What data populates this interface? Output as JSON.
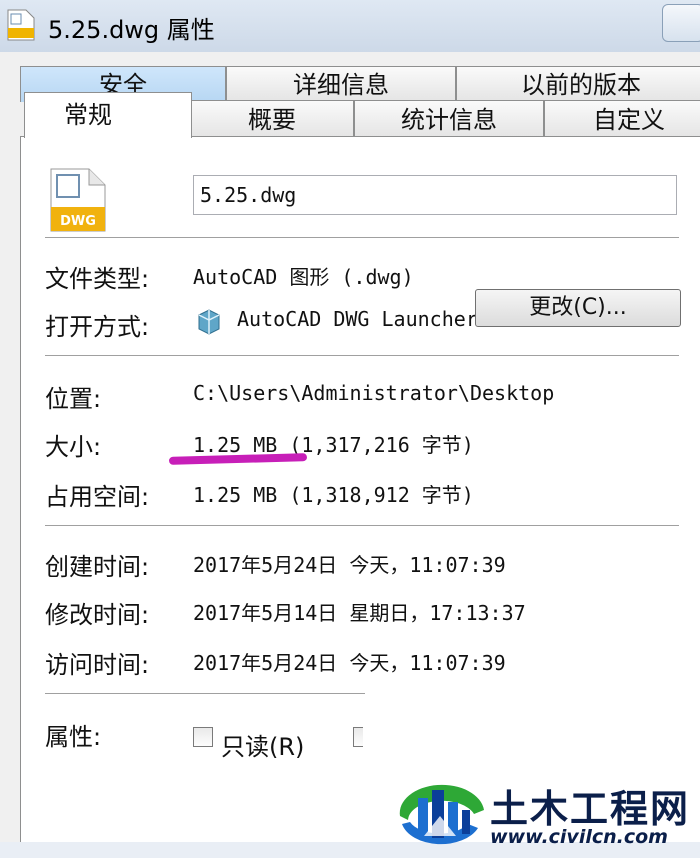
{
  "window": {
    "title": "5.25.dwg 属性"
  },
  "tabs_back": [
    "安全",
    "详细信息",
    "以前的版本"
  ],
  "tabs_front": [
    "常规",
    "概要",
    "统计信息",
    "自定义"
  ],
  "general": {
    "file_name": "5.25.dwg",
    "file_icon_label": "DWG",
    "type_label": "文件类型:",
    "type_value": "AutoCAD 图形 (.dwg)",
    "opens_with_label": "打开方式:",
    "opens_with_value": "AutoCAD DWG Launcher",
    "change_button": "更改(C)...",
    "location_label": "位置:",
    "location_value": "C:\\Users\\Administrator\\Desktop",
    "size_label": "大小:",
    "size_value": "1.25 MB (1,317,216 字节)",
    "size_on_disk_label": "占用空间:",
    "size_on_disk_value": "1.25 MB (1,318,912 字节)",
    "created_label": "创建时间:",
    "created_value": "2017年5月24日 今天，11:07:39",
    "modified_label": "修改时间:",
    "modified_value": "2017年5月14日 星期日，17:13:37",
    "accessed_label": "访问时间:",
    "accessed_value": "2017年5月24日 今天，11:07:39",
    "attributes_label": "属性:",
    "readonly_label": "只读(R)",
    "readonly_checked": false
  },
  "watermark": {
    "title": "土木工程网",
    "url": "www.civilcn.com"
  },
  "colors": {
    "highlight_underline": "#c71fb8",
    "tab_blue": "#b7d7f3",
    "watermark_navy": "#0b1f4a",
    "watermark_green": "#2ea836",
    "watermark_blue": "#1d6fd0"
  }
}
